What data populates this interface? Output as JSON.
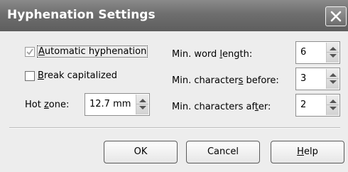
{
  "dialog": {
    "title": "Hyphenation Settings"
  },
  "options": {
    "automatic": {
      "pre": "",
      "ul": "A",
      "post": "utomatic hyphenation",
      "checked": true
    },
    "break_caps": {
      "pre": "",
      "ul": "B",
      "post": "reak capitalized",
      "checked": false
    }
  },
  "hot_zone": {
    "pre": "Hot ",
    "ul": "z",
    "post": "one:",
    "value": "12.7 mm"
  },
  "fields": {
    "min_word_length": {
      "pre": "Min. word ",
      "ul": "l",
      "post": "ength:",
      "value": "6"
    },
    "min_chars_before": {
      "pre": "Min. character",
      "ul": "s",
      "post": " before:",
      "value": "3"
    },
    "min_chars_after": {
      "pre": "Min. characters af",
      "ul": "t",
      "post": "er:",
      "value": "2"
    }
  },
  "buttons": {
    "ok": "OK",
    "cancel": "Cancel",
    "help": {
      "ul": "H",
      "post": "elp"
    }
  }
}
